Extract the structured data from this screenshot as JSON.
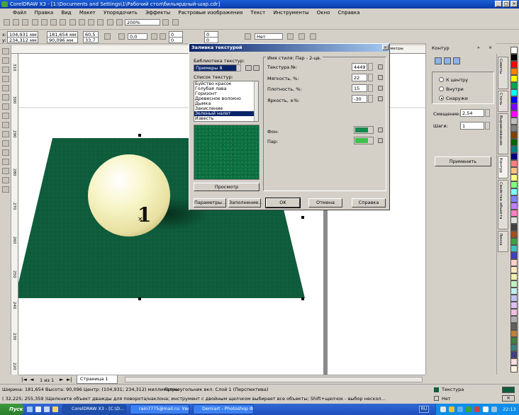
{
  "window": {
    "title": "CorelDRAW X3 - [1:\\Documents and Settings\\1\\Рабочий стол\\бильярдный-шар.cdr]"
  },
  "menu": [
    "Файл",
    "Правка",
    "Вид",
    "Макет",
    "Упорядочить",
    "Эффекты",
    "Растровые изображения",
    "Текст",
    "Инструменты",
    "Окно",
    "Справка"
  ],
  "toolbar": {
    "zoom": "200%"
  },
  "property_bar": {
    "x": "104,931 мм",
    "y": "234,312 мм",
    "width": "181,654 мм",
    "height": "90,096 мм",
    "scale_x": "60,5",
    "scale_y": "33,7",
    "angle": "0,0",
    "nudge_1a": "0",
    "nudge_1b": "0",
    "nudge_2a": "0",
    "nudge_2b": "0",
    "outline": "Нет"
  },
  "rulers": {
    "units": "миллиметры",
    "left_ticks": [
      "310",
      "300",
      "290",
      "280",
      "270",
      "260",
      "250",
      "240",
      "230",
      "220"
    ]
  },
  "dialog": {
    "title": "Заливка текстурой",
    "library_label": "Библиотека текстур:",
    "library_value": "Примеры 8",
    "list_label": "Список текстур:",
    "list_items": [
      "Буйство красок",
      "Голубая лава",
      "Горизонт",
      "Древесное волокно",
      "Дымка",
      "Закисление",
      "Зеленый налет",
      "Известь"
    ],
    "selected_item": "Зеленый налет",
    "style_name": "Имя стиля: Пар - 2-цв.",
    "params": [
      {
        "label": "Текстура №:",
        "value": "4449"
      },
      {
        "label": "Мягкость, %:",
        "value": "22"
      },
      {
        "label": "Плотность, %:",
        "value": "15"
      },
      {
        "label": "Яркость, ±%:",
        "value": "-30"
      }
    ],
    "color_params": [
      {
        "label": "Фон:",
        "color": "#138a4e"
      },
      {
        "label": "Пар:",
        "color": "#3cc24a"
      }
    ],
    "preview_button": "Просмотр",
    "buttons": {
      "options": "Параметры...",
      "tiling": "Заполнение...",
      "ok": "OK",
      "cancel": "Отмена",
      "help": "Справка"
    }
  },
  "docker": {
    "title": "Контур",
    "positions": [
      "К центру",
      "Внутри",
      "Снаружи"
    ],
    "selected_position": "Снаружи",
    "offset_label": "Смещение:",
    "offset_value": "2,54",
    "steps_label": "Шаги:",
    "steps_value": "1",
    "apply_button": "Применить",
    "tabs": [
      "Советы",
      "Стиль",
      "Выравнивание",
      "Контур",
      "Свойства объекта",
      "Линза"
    ]
  },
  "canvas": {
    "ball_number": "1",
    "texture_color": "#0f5c3c"
  },
  "document_bar": {
    "page_counter": "1 из 1",
    "page_tab": "Страница 1"
  },
  "status": {
    "line1": "Ширина: 181,654 Высота: 90,096 Центр: (104,931; 234,312) миллиметры",
    "object": "Прямоугольник вкл. Слой 1  (Перспектива)",
    "coords": "( 32,225; 255,359 )",
    "hint": "Щелкните объект дважды для поворота/наклона; инструмент с двойным щелчком выбирает все объекты; Shift+щелчок - выбор нескол...",
    "fill_label": "Текстура",
    "outline_label": "Нет"
  },
  "taskbar": {
    "start": "Пуск",
    "tasks": [
      "CorelDRAW X3 - [C:\\D...",
      "[C:\\D...",
      "rain7775@mail.ru: Увед...",
      "Demiart - Photoshop Фо..."
    ],
    "lang": "RU",
    "clock": "22:13"
  },
  "palette_colors": [
    "#ffffff",
    "#000000",
    "#ff0000",
    "#ff8000",
    "#ffff00",
    "#00a651",
    "#00ffff",
    "#0000ff",
    "#8000ff",
    "#ff00ff",
    "#c0c0c0",
    "#808080",
    "#804000",
    "#006600",
    "#008080",
    "#000080",
    "#ff8080",
    "#ffc080",
    "#ffff80",
    "#80ff80",
    "#80ffff",
    "#8080ff",
    "#c080ff",
    "#ff80c0",
    "#e0e0e0",
    "#404040",
    "#a05020",
    "#40a040",
    "#40c0c0",
    "#4040c0",
    "#ffd0d0",
    "#ffe8c0",
    "#f0f0b0",
    "#c0f0c0",
    "#c0f0f0",
    "#c0c0f0",
    "#e0c0f0",
    "#f0c0e0",
    "#b0b0b0",
    "#606060",
    "#c08040",
    "#408040",
    "#408080",
    "#404080",
    "#ffe0e0",
    "#fff0e0"
  ]
}
